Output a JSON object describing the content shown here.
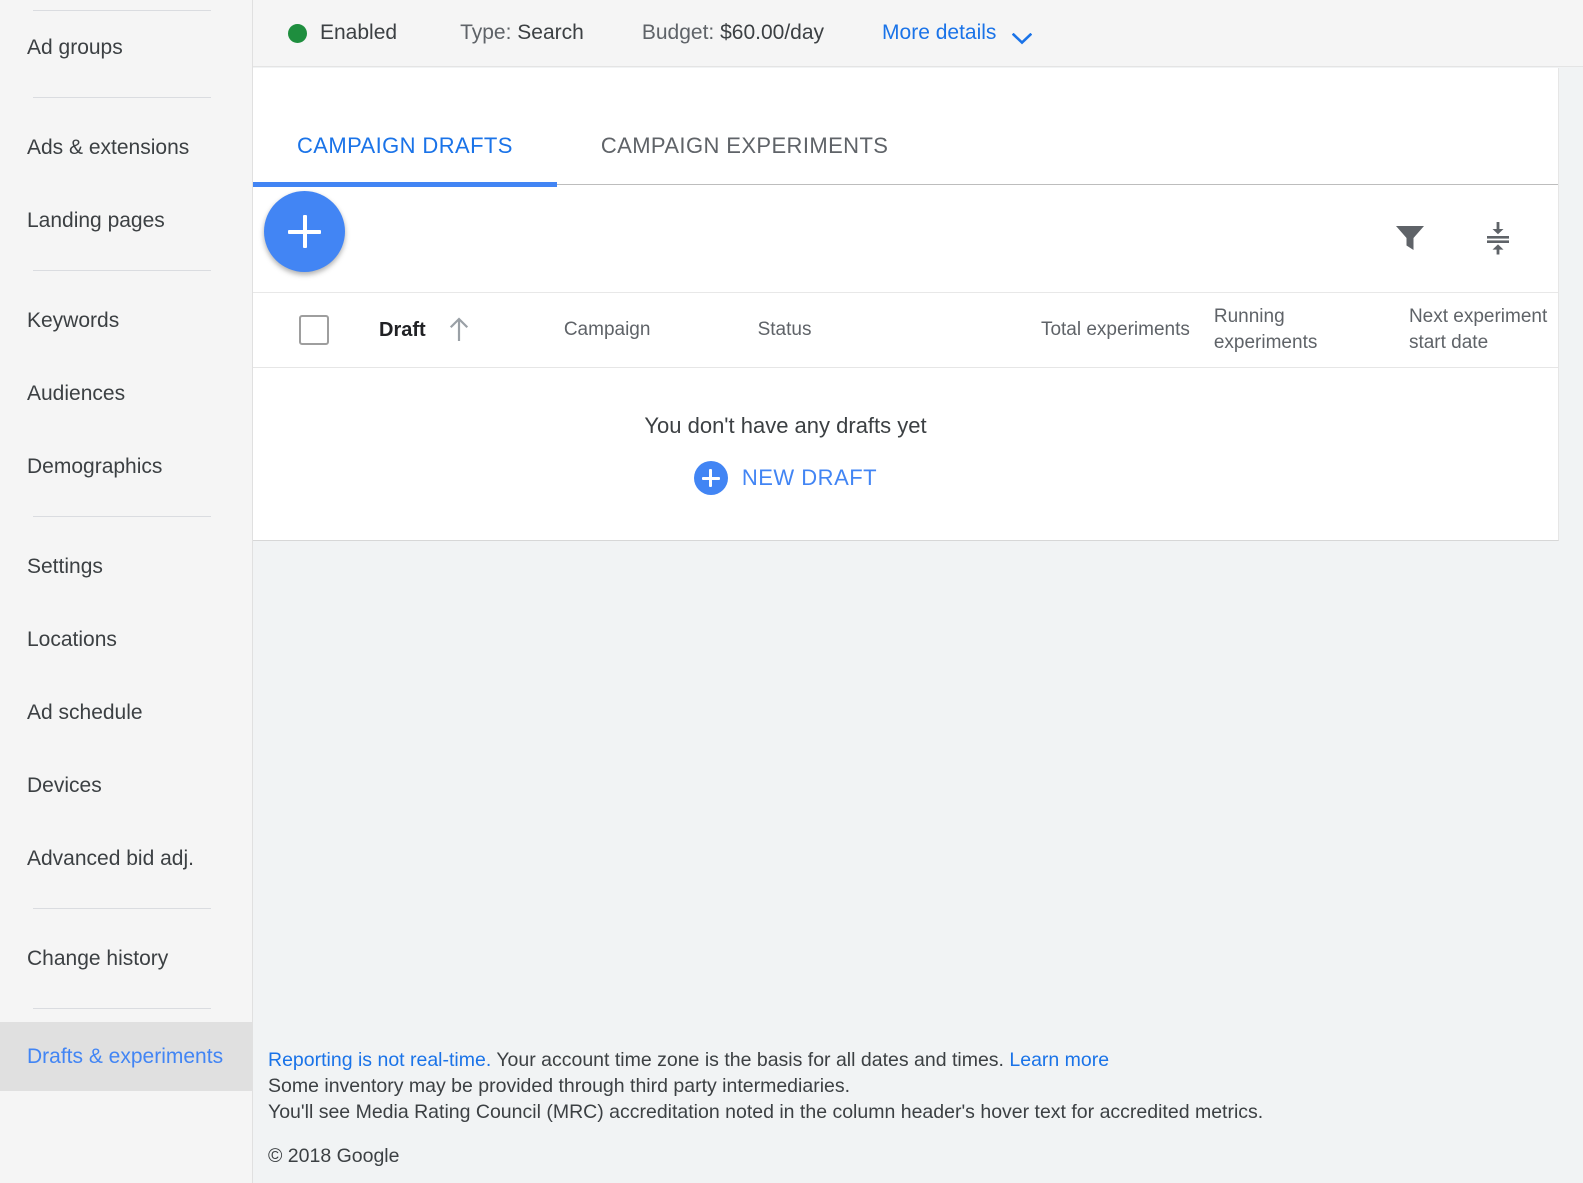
{
  "sidebar": {
    "items": [
      {
        "label": "Ad groups",
        "selected": false,
        "divider_after": true
      },
      {
        "label": "Ads & extensions",
        "selected": false,
        "divider_after": false
      },
      {
        "label": "Landing pages",
        "selected": false,
        "divider_after": true
      },
      {
        "label": "Keywords",
        "selected": false,
        "divider_after": false
      },
      {
        "label": "Audiences",
        "selected": false,
        "divider_after": false
      },
      {
        "label": "Demographics",
        "selected": false,
        "divider_after": true
      },
      {
        "label": "Settings",
        "selected": false,
        "divider_after": false
      },
      {
        "label": "Locations",
        "selected": false,
        "divider_after": false
      },
      {
        "label": "Ad schedule",
        "selected": false,
        "divider_after": false
      },
      {
        "label": "Devices",
        "selected": false,
        "divider_after": false
      },
      {
        "label": "Advanced bid adj.",
        "selected": false,
        "divider_after": true
      },
      {
        "label": "Change history",
        "selected": false,
        "divider_after": true
      },
      {
        "label": "Drafts & experiments",
        "selected": true,
        "divider_after": false
      }
    ]
  },
  "status_bar": {
    "state": "Enabled",
    "state_dot_color": "#1e8e3e",
    "type_label": "Type:",
    "type_value": "Search",
    "budget_label": "Budget:",
    "budget_value": "$60.00/day",
    "more_details": "More details",
    "chevron_icon": "chevron-down-icon"
  },
  "tabs": [
    {
      "label": "CAMPAIGN DRAFTS",
      "active": true
    },
    {
      "label": "CAMPAIGN EXPERIMENTS",
      "active": false
    }
  ],
  "toolbar": {
    "add_button_icon": "plus-icon",
    "filter_icon": "filter-icon",
    "split_view_icon": "split-rows-icon"
  },
  "table": {
    "select_all_checkbox": "unchecked",
    "sort_icon": "sort-ascending-arrow-icon",
    "columns": [
      {
        "key": "draft",
        "label": "Draft",
        "sorted": true,
        "align": "left"
      },
      {
        "key": "campaign",
        "label": "Campaign",
        "sorted": false,
        "align": "left"
      },
      {
        "key": "status",
        "label": "Status",
        "sorted": false,
        "align": "left"
      },
      {
        "key": "total_experiments",
        "label": "Total experiments",
        "sorted": false,
        "align": "right"
      },
      {
        "key": "running_experiments",
        "label": "Running experiments",
        "sorted": false,
        "align": "left"
      },
      {
        "key": "next_experiment_start_date",
        "label": "Next experiment start date",
        "sorted": false,
        "align": "left"
      }
    ],
    "rows": []
  },
  "empty_state": {
    "message": "You don't have any drafts yet",
    "action_label": "NEW DRAFT",
    "action_icon": "plus-circle-icon"
  },
  "footer": {
    "line1_link": "Reporting is not real-time.",
    "line1_text": " Your account time zone is the basis for all dates and times. ",
    "line1_link2": "Learn more",
    "line2": "Some inventory may be provided through third party intermediaries.",
    "line3": "You'll see Media Rating Council (MRC) accreditation noted in the column header's hover text for accredited metrics.",
    "copyright": "© 2018 Google"
  },
  "colors": {
    "accent_blue": "#4285f4",
    "link_blue": "#1a73e8",
    "green": "#1e8e3e",
    "sidebar_bg": "#f5f5f5",
    "selected_bg": "#e0e0e0",
    "page_bg": "#f1f3f4"
  }
}
